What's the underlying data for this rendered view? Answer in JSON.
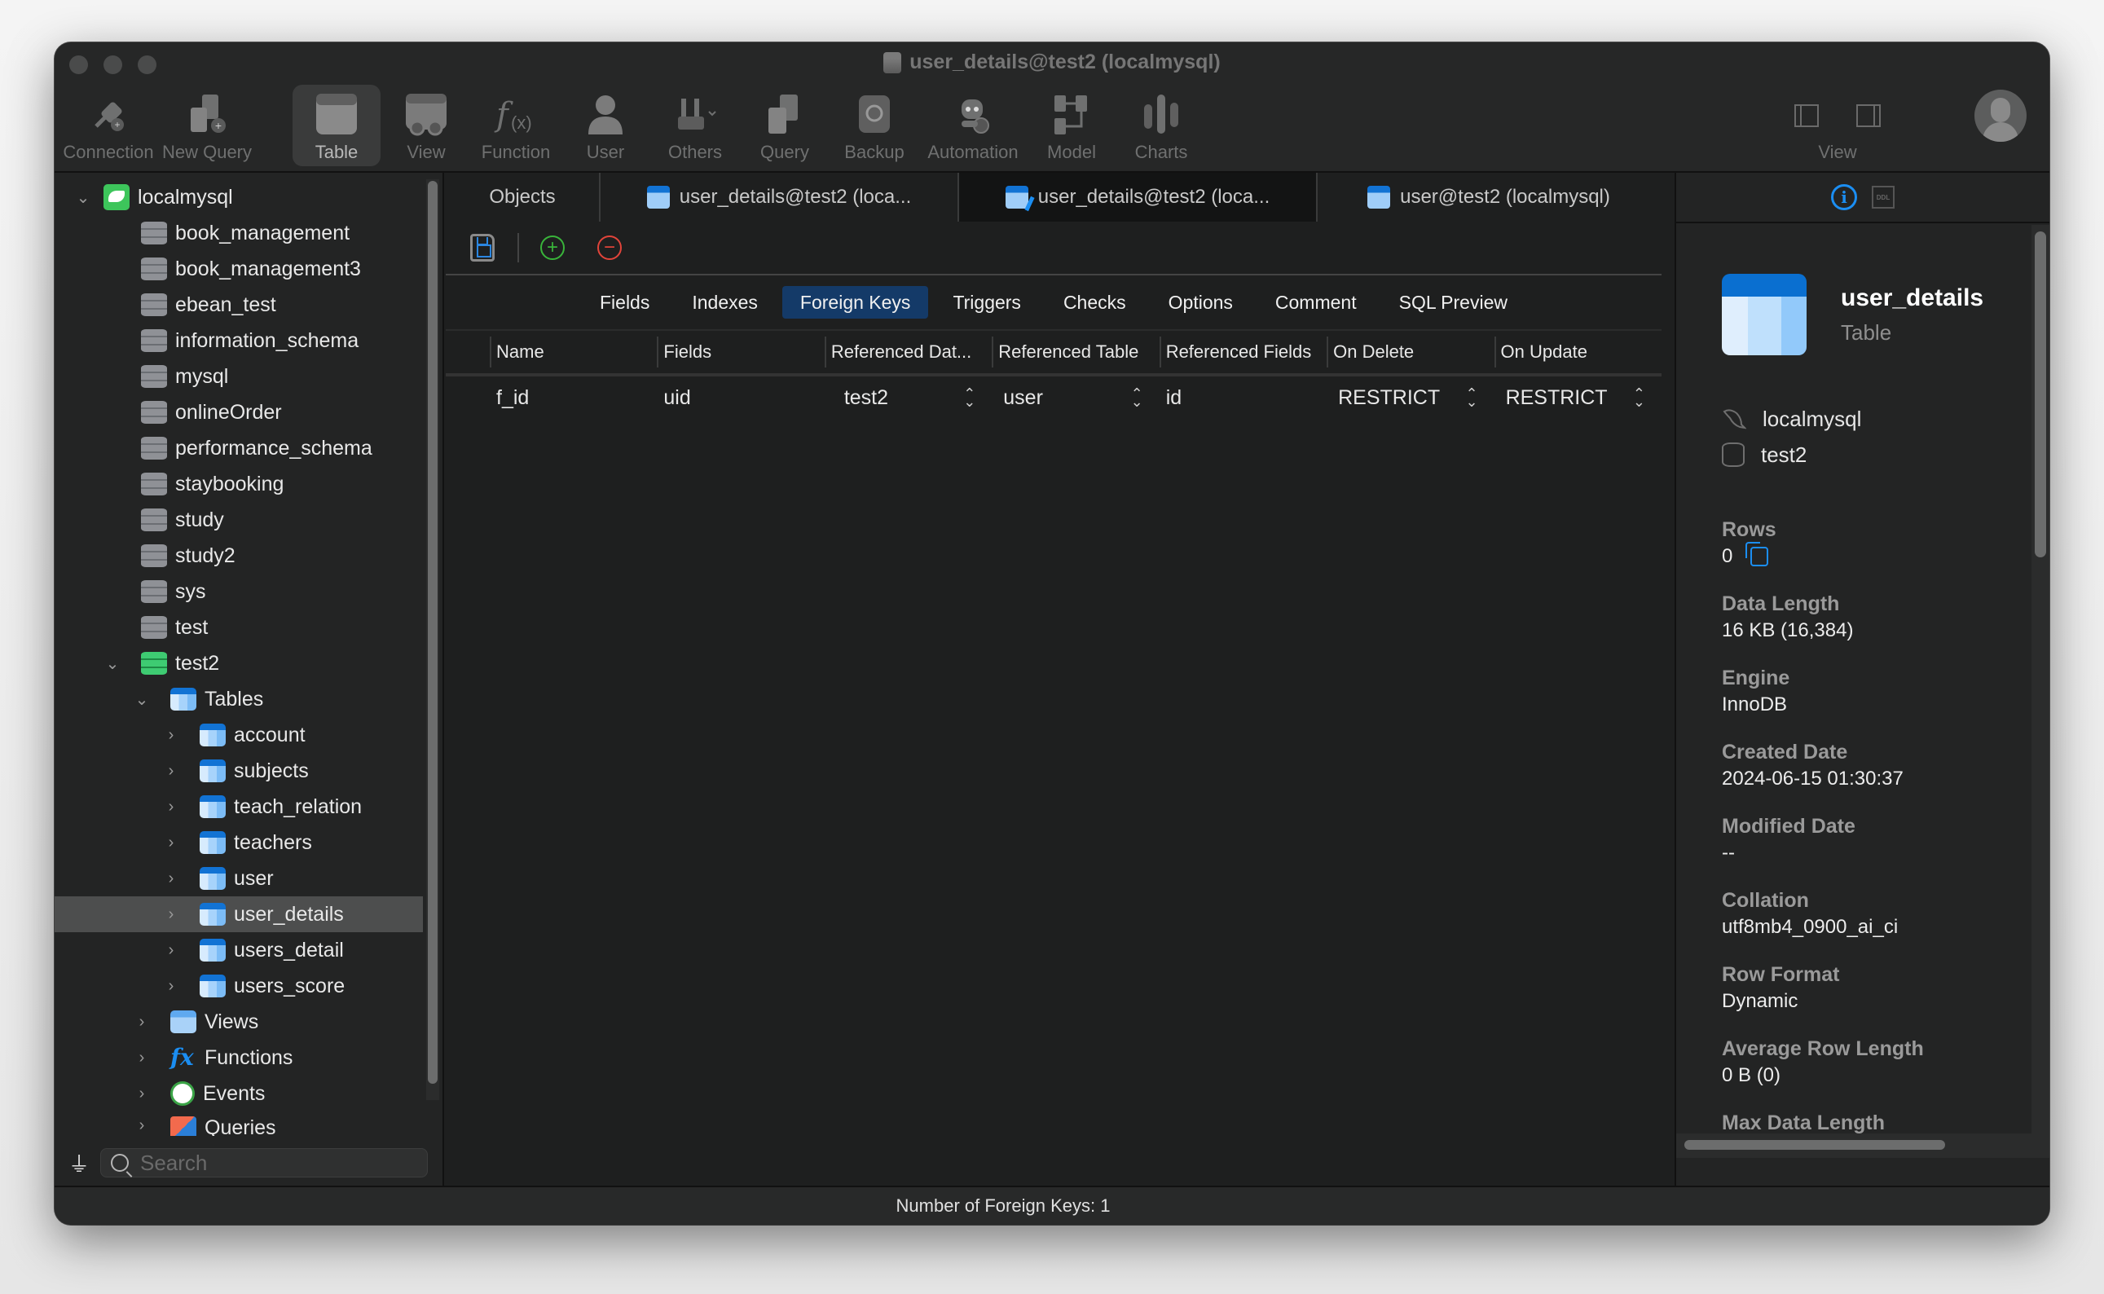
{
  "window": {
    "title": "user_details@test2 (localmysql)"
  },
  "toolbar": {
    "items": [
      {
        "label": "Connection",
        "icon": "connection-plug-icon"
      },
      {
        "label": "New Query",
        "icon": "new-query-icon"
      },
      {
        "label": "Table",
        "icon": "table-icon",
        "active": true
      },
      {
        "label": "View",
        "icon": "view-icon"
      },
      {
        "label": "Function",
        "icon": "function-icon"
      },
      {
        "label": "User",
        "icon": "user-icon"
      },
      {
        "label": "Others",
        "icon": "tools-icon"
      },
      {
        "label": "Query",
        "icon": "query-icon"
      },
      {
        "label": "Backup",
        "icon": "backup-icon"
      },
      {
        "label": "Automation",
        "icon": "automation-robot-icon"
      },
      {
        "label": "Model",
        "icon": "model-icon"
      },
      {
        "label": "Charts",
        "icon": "charts-icon"
      }
    ],
    "view_label": "View"
  },
  "sidebar": {
    "connection": "localmysql",
    "databases": [
      "book_management",
      "book_management3",
      "ebean_test",
      "information_schema",
      "mysql",
      "onlineOrder",
      "performance_schema",
      "staybooking",
      "study",
      "study2",
      "sys",
      "test"
    ],
    "open_database": "test2",
    "tables_label": "Tables",
    "tables": [
      "account",
      "subjects",
      "teach_relation",
      "teachers",
      "user",
      "user_details",
      "users_detail",
      "users_score"
    ],
    "selected_table": "user_details",
    "groups": [
      "Views",
      "Functions",
      "Events",
      "Queries"
    ],
    "search_placeholder": "Search"
  },
  "tabs": [
    {
      "label": "Objects"
    },
    {
      "label": "user_details@test2 (loca..."
    },
    {
      "label": "user_details@test2 (loca...",
      "active": true
    },
    {
      "label": "user@test2 (localmysql)"
    }
  ],
  "editor": {
    "subtabs": [
      "Fields",
      "Indexes",
      "Foreign Keys",
      "Triggers",
      "Checks",
      "Options",
      "Comment",
      "SQL Preview"
    ],
    "active_subtab": "Foreign Keys",
    "columns": [
      "Name",
      "Fields",
      "Referenced Dat...",
      "Referenced Table",
      "Referenced Fields",
      "On Delete",
      "On Update"
    ],
    "rows": [
      {
        "name": "f_id",
        "fields": "uid",
        "referenced_database": "test2",
        "referenced_table": "user",
        "referenced_fields": "id",
        "on_delete": "RESTRICT",
        "on_update": "RESTRICT"
      }
    ]
  },
  "info_panel": {
    "name": "user_details",
    "type": "Table",
    "connection": "localmysql",
    "database": "test2",
    "properties": [
      {
        "key": "Rows",
        "value": "0"
      },
      {
        "key": "Data Length",
        "value": "16 KB (16,384)"
      },
      {
        "key": "Engine",
        "value": "InnoDB"
      },
      {
        "key": "Created Date",
        "value": "2024-06-15 01:30:37"
      },
      {
        "key": "Modified Date",
        "value": "--"
      },
      {
        "key": "Collation",
        "value": "utf8mb4_0900_ai_ci"
      },
      {
        "key": "Row Format",
        "value": "Dynamic"
      },
      {
        "key": "Average Row Length",
        "value": "0 B (0)"
      },
      {
        "key": "Max Data Length",
        "value": ""
      }
    ],
    "ddl_label": "DDL"
  },
  "statusbar": {
    "text": "Number of Foreign Keys: 1"
  },
  "colors": {
    "accent": "#1b8ef2",
    "active_subtab": "#143a68",
    "add": "#39b43a",
    "remove": "#e2443a",
    "db_open": "#3ecb72"
  }
}
